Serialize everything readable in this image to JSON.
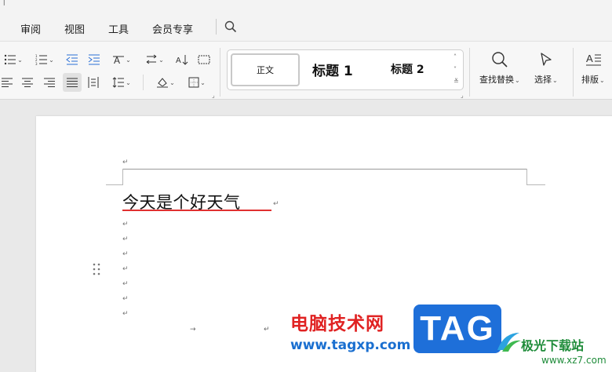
{
  "menubar": {
    "tabs": [
      {
        "label": "审阅"
      },
      {
        "label": "视图"
      },
      {
        "label": "工具"
      },
      {
        "label": "会员专享"
      }
    ]
  },
  "ribbon": {
    "styles": {
      "normal": "正文",
      "heading1": "标题 1",
      "heading2": "标题 2"
    },
    "find_replace": "查找替换",
    "select": "选择",
    "layout": "排版"
  },
  "document": {
    "text": "今天是个好天气",
    "paragraph_mark": "↵",
    "tab_mark": "→"
  },
  "watermark": {
    "cn_title": "电脑技术网",
    "url": "www.tagxp.com",
    "tag": "TAG",
    "site_cn": "极光下载站",
    "site_url": "www.xz7.com"
  },
  "colors": {
    "accent_red": "#e03030",
    "watermark_blue": "#1e6fd9",
    "watermark_green": "#1f8c3a"
  }
}
